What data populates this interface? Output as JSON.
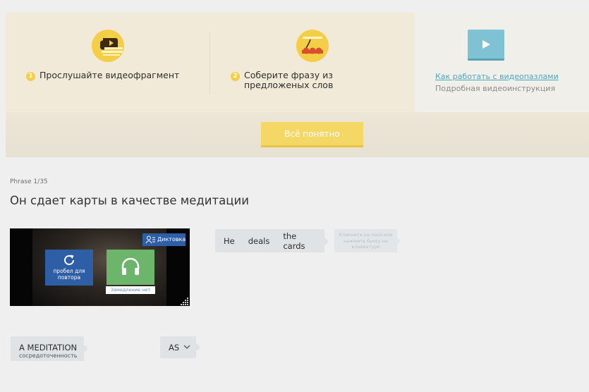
{
  "intro": {
    "step1": {
      "number": "1",
      "text": "Прослушайте видеофрагмент"
    },
    "step2": {
      "number": "2",
      "text": "Соберите фразу из предложеных слов"
    },
    "help": {
      "link": "Как работать с видеопазлами",
      "subtitle": "Подробная видеоинструкция"
    },
    "ok_button": "Всё понятно"
  },
  "phrase": {
    "counter": "Phrase 1/35",
    "title": "Он сдает карты в качестве медитации"
  },
  "video": {
    "dictation_label": "Диктовка",
    "repeat_label": "пробел для повтора",
    "slowdown_label": "Замедление нет"
  },
  "answer": {
    "words": [
      "He",
      "deals",
      "the cards"
    ],
    "hint": "Кликните на пазл или нажмите букву на клавиатуре"
  },
  "options": [
    {
      "word": "A MEDITATION",
      "translation": "сосредоточенность"
    },
    {
      "word": "AS"
    }
  ],
  "colors": {
    "accent_yellow": "#f5ce48",
    "link_blue": "#4aa7c4",
    "control_blue": "#2e5fa6",
    "listen_green": "#6cb56b",
    "tile_gray": "#dfe3e6"
  }
}
